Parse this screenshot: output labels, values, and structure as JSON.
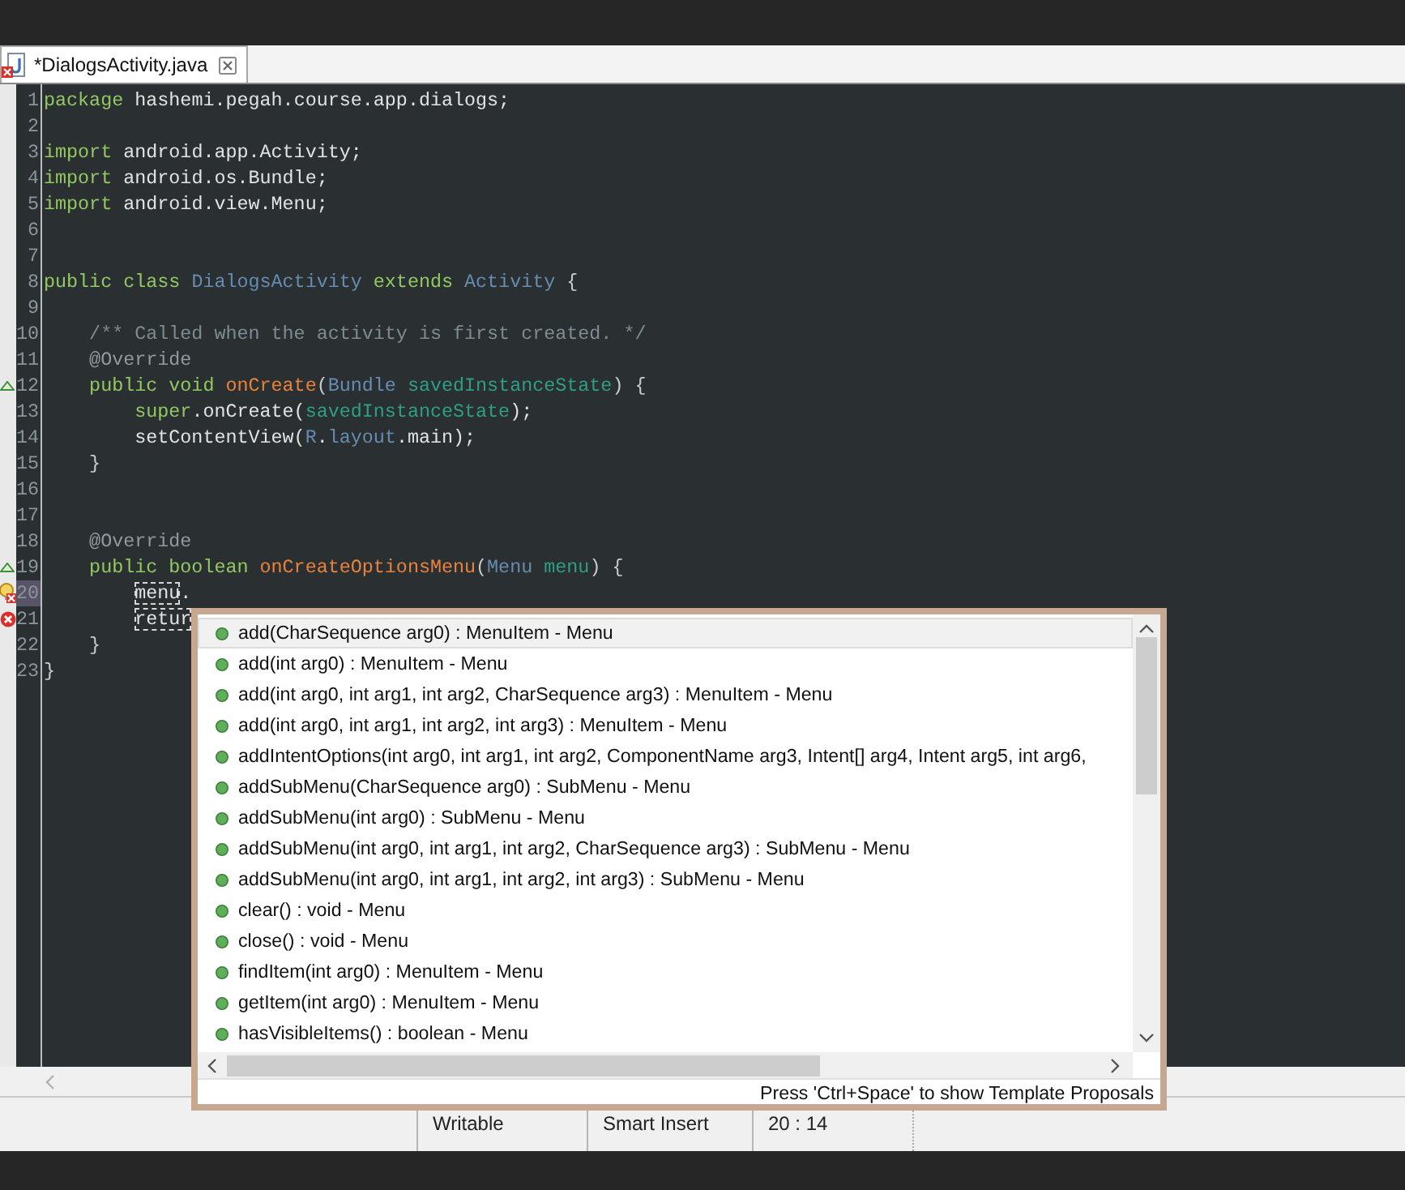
{
  "editor_tab": {
    "title": "*DialogsActivity.java",
    "selected": true
  },
  "code": {
    "lines": [
      {
        "number": "1",
        "current": false,
        "tokens": [
          {
            "kind": "keyword",
            "text": "package"
          },
          {
            "kind": "plain",
            "text": " hashemi.pegah.course.app.dialogs;"
          }
        ]
      },
      {
        "number": "2",
        "current": false
      },
      {
        "number": "3",
        "current": false,
        "tokens": [
          {
            "kind": "keyword",
            "text": "import"
          },
          {
            "kind": "plain",
            "text": " android.app.Activity;"
          }
        ]
      },
      {
        "number": "4",
        "current": false,
        "tokens": [
          {
            "kind": "keyword",
            "text": "import"
          },
          {
            "kind": "plain",
            "text": " android.os.Bundle;"
          }
        ]
      },
      {
        "number": "5",
        "current": false,
        "tokens": [
          {
            "kind": "keyword",
            "text": "import"
          },
          {
            "kind": "plain",
            "text": " android.view.Menu;"
          }
        ]
      },
      {
        "number": "6",
        "current": false
      },
      {
        "number": "7",
        "current": false
      },
      {
        "number": "8",
        "current": false,
        "tokens": [
          {
            "kind": "keyword",
            "text": "public class "
          },
          {
            "kind": "type",
            "text": "DialogsActivity "
          },
          {
            "kind": "keyword",
            "text": "extends "
          },
          {
            "kind": "type",
            "text": "Activity"
          },
          {
            "kind": "brace",
            "text": " {"
          }
        ]
      },
      {
        "number": "9",
        "current": false
      },
      {
        "number": "10",
        "current": false,
        "tokens": [
          {
            "kind": "comment",
            "text": "    /** Called when the activity is first created. */"
          }
        ]
      },
      {
        "number": "11",
        "current": false,
        "tokens": [
          {
            "kind": "annotation",
            "text": "    @Override"
          }
        ]
      },
      {
        "number": "12",
        "current": false,
        "marker": {
          "kind": "override"
        },
        "tokens": [
          {
            "kind": "keyword",
            "text": "    public void "
          },
          {
            "kind": "method",
            "text": "onCreate"
          },
          {
            "kind": "brace",
            "text": "("
          },
          {
            "kind": "type",
            "text": "Bundle "
          },
          {
            "kind": "field",
            "text": "savedInstanceState"
          },
          {
            "kind": "brace",
            "text": ") {"
          }
        ]
      },
      {
        "number": "13",
        "current": false,
        "tokens": [
          {
            "kind": "keyword",
            "text": "        super"
          },
          {
            "kind": "plain",
            "text": ".onCreate("
          },
          {
            "kind": "field",
            "text": "savedInstanceState"
          },
          {
            "kind": "plain",
            "text": ");"
          }
        ]
      },
      {
        "number": "14",
        "current": false,
        "tokens": [
          {
            "kind": "plain",
            "text": "        setContentView("
          },
          {
            "kind": "type",
            "text": "R"
          },
          {
            "kind": "plain",
            "text": "."
          },
          {
            "kind": "type",
            "text": "layout"
          },
          {
            "kind": "plain",
            "text": ".main);"
          }
        ]
      },
      {
        "number": "15",
        "current": false,
        "tokens": [
          {
            "kind": "brace",
            "text": "    }"
          }
        ]
      },
      {
        "number": "16",
        "current": false
      },
      {
        "number": "17",
        "current": false
      },
      {
        "number": "18",
        "current": false,
        "tokens": [
          {
            "kind": "annotation",
            "text": "    @Override"
          }
        ]
      },
      {
        "number": "19",
        "current": false,
        "marker": {
          "kind": "override"
        },
        "tokens": [
          {
            "kind": "keyword",
            "text": "    public boolean "
          },
          {
            "kind": "method",
            "text": "onCreateOptionsMenu"
          },
          {
            "kind": "brace",
            "text": "("
          },
          {
            "kind": "type",
            "text": "Menu "
          },
          {
            "kind": "field",
            "text": "menu"
          },
          {
            "kind": "brace",
            "text": ") {"
          }
        ]
      },
      {
        "number": "20",
        "current": true,
        "marker": {
          "kind": "quickfix_error"
        },
        "tokens": [
          {
            "kind": "pending",
            "text": "        menu"
          },
          {
            "kind": "plain",
            "text": "."
          }
        ]
      },
      {
        "number": "21",
        "current": false,
        "marker": {
          "kind": "error"
        },
        "tokens": [
          {
            "kind": "pending",
            "text": "        retur"
          }
        ]
      },
      {
        "number": "22",
        "current": false,
        "tokens": [
          {
            "kind": "brace",
            "text": "    }"
          }
        ]
      },
      {
        "number": "23",
        "current": false,
        "tokens": [
          {
            "kind": "brace",
            "text": "}"
          }
        ]
      }
    ]
  },
  "completion_popup": {
    "items": [
      {
        "text": "add(CharSequence arg0) : MenuItem - Menu",
        "selected": true
      },
      {
        "text": "add(int arg0) : MenuItem - Menu",
        "selected": false
      },
      {
        "text": "add(int arg0, int arg1, int arg2, CharSequence arg3) : MenuItem - Menu",
        "selected": false
      },
      {
        "text": "add(int arg0, int arg1, int arg2, int arg3) : MenuItem - Menu",
        "selected": false
      },
      {
        "text": "addIntentOptions(int arg0, int arg1, int arg2, ComponentName arg3, Intent[] arg4, Intent arg5, int arg6,",
        "selected": false
      },
      {
        "text": "addSubMenu(CharSequence arg0) : SubMenu - Menu",
        "selected": false
      },
      {
        "text": "addSubMenu(int arg0) : SubMenu - Menu",
        "selected": false
      },
      {
        "text": "addSubMenu(int arg0, int arg1, int arg2, CharSequence arg3) : SubMenu - Menu",
        "selected": false
      },
      {
        "text": "addSubMenu(int arg0, int arg1, int arg2, int arg3) : SubMenu - Menu",
        "selected": false
      },
      {
        "text": "clear() : void - Menu",
        "selected": false
      },
      {
        "text": "close() : void - Menu",
        "selected": false
      },
      {
        "text": "findItem(int arg0) : MenuItem - Menu",
        "selected": false
      },
      {
        "text": "getItem(int arg0) : MenuItem - Menu",
        "selected": false
      },
      {
        "text": "hasVisibleItems() : boolean - Menu",
        "selected": false
      }
    ],
    "footer": "Press 'Ctrl+Space' to show Template Proposals"
  },
  "status_bar": {
    "fields": [
      "Writable",
      "Smart Insert",
      "20 : 14"
    ]
  }
}
